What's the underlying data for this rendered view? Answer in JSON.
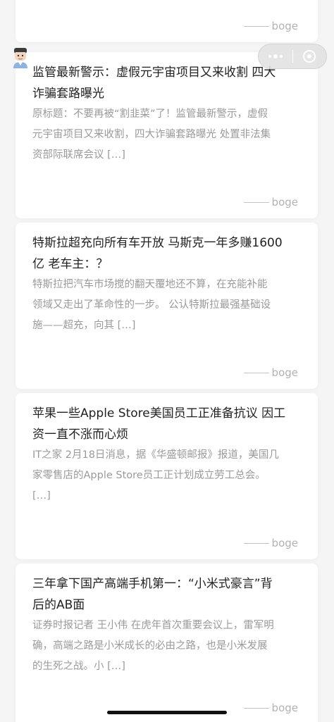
{
  "author_suffix": "boge",
  "cards": [
    {
      "title": "",
      "excerpt": "",
      "author": "boge"
    },
    {
      "title": "监管最新警示：虚假元宇宙项目又来收割 四大\n诈骗套路曝光",
      "excerpt": "原标题：不要再被“割韭菜”了！监管最新警示，虚假\n元宇宙项目又来收割，四大诈骗套路曝光 处置非法集\n资部际联席会议 […]",
      "author": "boge"
    },
    {
      "title": "特斯拉超充向所有车开放 马斯克一年多赚1600\n亿 老车主：？",
      "excerpt": "特斯拉把汽车市场搅的翻天覆地还不算，在充能补能\n领域又走出了革命性的一步。 公认特斯拉最强基础设\n施——超充，向其 […]",
      "author": "boge"
    },
    {
      "title": "苹果一些Apple Store美国员工正准备抗议 因工\n资一直不涨而心烦",
      "excerpt": "IT之家 2月18日消息，据《华盛顿邮报》报道，美国几\n家零售店的Apple Store员工正计划成立劳工总会。\n[…]",
      "author": "boge"
    },
    {
      "title": "三年拿下国产高端手机第一：“小米式豪言”背\n后的AB面",
      "excerpt": "证券时报记者 王小伟 在虎年首次重要会议上，雷军明\n确，高端之路是小米成长的必由之路，也是小米发展\n的生死之战。小 […]",
      "author": "boge"
    }
  ],
  "icons": {
    "capsule_menu": "more-dots-icon",
    "capsule_close": "close-ring-icon",
    "avatar": "avatar-icon"
  },
  "colors": {
    "background": "#f5f5f5",
    "card": "#ffffff",
    "title": "#222222",
    "excerpt": "#9a9a9a",
    "author": "#b2b2b2"
  }
}
